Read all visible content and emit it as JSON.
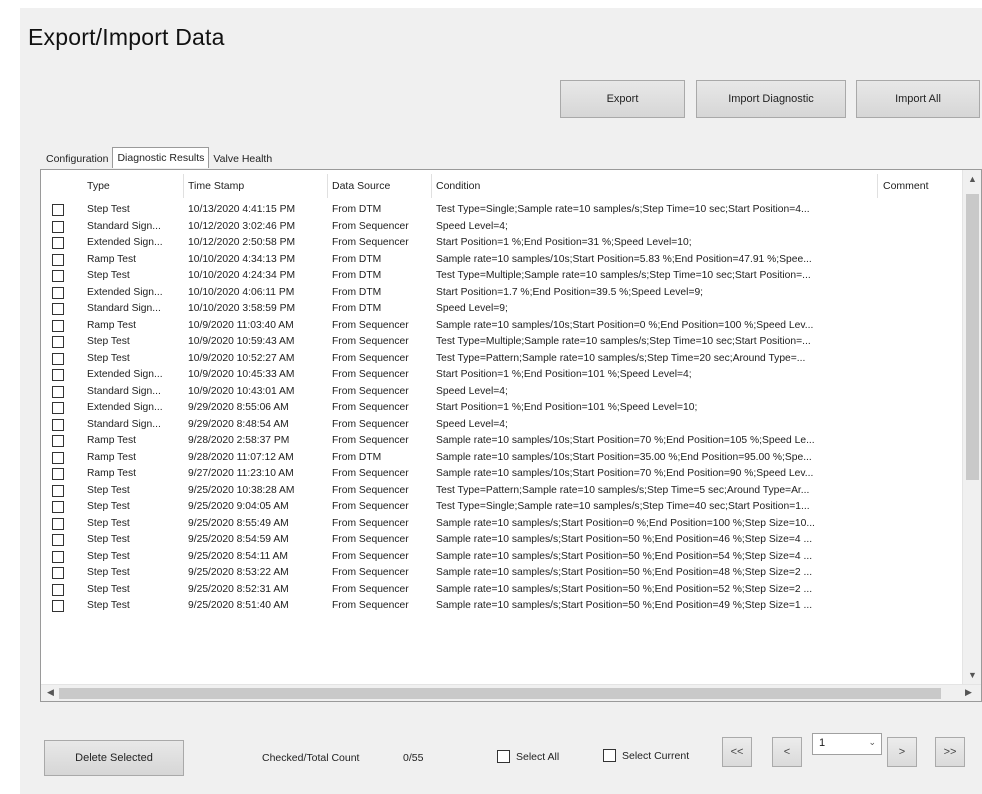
{
  "title": "Export/Import Data",
  "buttons": {
    "export": "Export",
    "import_diagnostic": "Import Diagnostic",
    "import_all": "Import All",
    "delete_selected": "Delete Selected"
  },
  "tabs": [
    {
      "label": "Configuration"
    },
    {
      "label": "Diagnostic Results"
    },
    {
      "label": "Valve Health"
    }
  ],
  "table": {
    "columns": [
      "Type",
      "Time Stamp",
      "Data Source",
      "Condition",
      "Comment"
    ],
    "rows": [
      {
        "type": "Step Test",
        "ts": "10/13/2020 4:41:15 PM",
        "src": "From DTM",
        "cond": "Test Type=Single;Sample rate=10 samples/s;Step Time=10 sec;Start Position=4..."
      },
      {
        "type": "Standard Sign...",
        "ts": "10/12/2020 3:02:46 PM",
        "src": "From Sequencer",
        "cond": "Speed Level=4;"
      },
      {
        "type": "Extended Sign...",
        "ts": "10/12/2020 2:50:58 PM",
        "src": "From Sequencer",
        "cond": "Start Position=1 %;End Position=31 %;Speed Level=10;"
      },
      {
        "type": "Ramp Test",
        "ts": "10/10/2020 4:34:13 PM",
        "src": "From DTM",
        "cond": "Sample rate=10 samples/10s;Start Position=5.83 %;End Position=47.91 %;Spee..."
      },
      {
        "type": "Step Test",
        "ts": "10/10/2020 4:24:34 PM",
        "src": "From DTM",
        "cond": "Test Type=Multiple;Sample rate=10 samples/s;Step Time=10 sec;Start Position=..."
      },
      {
        "type": "Extended Sign...",
        "ts": "10/10/2020 4:06:11 PM",
        "src": "From DTM",
        "cond": "Start Position=1.7 %;End Position=39.5 %;Speed Level=9;"
      },
      {
        "type": "Standard Sign...",
        "ts": "10/10/2020 3:58:59 PM",
        "src": "From DTM",
        "cond": "Speed Level=9;"
      },
      {
        "type": "Ramp Test",
        "ts": "10/9/2020 11:03:40 AM",
        "src": "From Sequencer",
        "cond": "Sample rate=10 samples/10s;Start Position=0 %;End Position=100 %;Speed Lev..."
      },
      {
        "type": "Step Test",
        "ts": "10/9/2020 10:59:43 AM",
        "src": "From Sequencer",
        "cond": "Test Type=Multiple;Sample rate=10 samples/s;Step Time=10 sec;Start Position=..."
      },
      {
        "type": "Step Test",
        "ts": "10/9/2020 10:52:27 AM",
        "src": "From Sequencer",
        "cond": "Test Type=Pattern;Sample rate=10 samples/s;Step Time=20 sec;Around Type=..."
      },
      {
        "type": "Extended Sign...",
        "ts": "10/9/2020 10:45:33 AM",
        "src": "From Sequencer",
        "cond": "Start Position=1 %;End Position=101 %;Speed Level=4;"
      },
      {
        "type": "Standard Sign...",
        "ts": "10/9/2020 10:43:01 AM",
        "src": "From Sequencer",
        "cond": "Speed Level=4;"
      },
      {
        "type": "Extended Sign...",
        "ts": "9/29/2020 8:55:06 AM",
        "src": "From Sequencer",
        "cond": "Start Position=1 %;End Position=101 %;Speed Level=10;"
      },
      {
        "type": "Standard Sign...",
        "ts": "9/29/2020 8:48:54 AM",
        "src": "From Sequencer",
        "cond": "Speed Level=4;"
      },
      {
        "type": "Ramp Test",
        "ts": "9/28/2020 2:58:37 PM",
        "src": "From Sequencer",
        "cond": "Sample rate=10 samples/10s;Start Position=70 %;End Position=105 %;Speed Le..."
      },
      {
        "type": "Ramp Test",
        "ts": "9/28/2020 11:07:12 AM",
        "src": "From DTM",
        "cond": "Sample rate=10 samples/10s;Start Position=35.00 %;End Position=95.00 %;Spe..."
      },
      {
        "type": "Ramp Test",
        "ts": "9/27/2020 11:23:10 AM",
        "src": "From Sequencer",
        "cond": "Sample rate=10 samples/10s;Start Position=70 %;End Position=90 %;Speed Lev..."
      },
      {
        "type": "Step Test",
        "ts": "9/25/2020 10:38:28 AM",
        "src": "From Sequencer",
        "cond": "Test Type=Pattern;Sample rate=10 samples/s;Step Time=5 sec;Around Type=Ar..."
      },
      {
        "type": "Step Test",
        "ts": "9/25/2020 9:04:05 AM",
        "src": "From Sequencer",
        "cond": "Test Type=Single;Sample rate=10 samples/s;Step Time=40 sec;Start Position=1..."
      },
      {
        "type": "Step Test",
        "ts": "9/25/2020 8:55:49 AM",
        "src": "From Sequencer",
        "cond": "Sample rate=10 samples/s;Start Position=0 %;End Position=100 %;Step Size=10..."
      },
      {
        "type": "Step Test",
        "ts": "9/25/2020 8:54:59 AM",
        "src": "From Sequencer",
        "cond": "Sample rate=10 samples/s;Start Position=50 %;End Position=46 %;Step Size=4 ..."
      },
      {
        "type": "Step Test",
        "ts": "9/25/2020 8:54:11 AM",
        "src": "From Sequencer",
        "cond": "Sample rate=10 samples/s;Start Position=50 %;End Position=54 %;Step Size=4 ..."
      },
      {
        "type": "Step Test",
        "ts": "9/25/2020 8:53:22 AM",
        "src": "From Sequencer",
        "cond": "Sample rate=10 samples/s;Start Position=50 %;End Position=48 %;Step Size=2 ..."
      },
      {
        "type": "Step Test",
        "ts": "9/25/2020 8:52:31 AM",
        "src": "From Sequencer",
        "cond": "Sample rate=10 samples/s;Start Position=50 %;End Position=52 %;Step Size=2 ..."
      },
      {
        "type": "Step Test",
        "ts": "9/25/2020 8:51:40 AM",
        "src": "From Sequencer",
        "cond": "Sample rate=10 samples/s;Start Position=50 %;End Position=49 %;Step Size=1 ..."
      }
    ]
  },
  "footer": {
    "count_label": "Checked/Total Count",
    "count_value": "0/55",
    "select_all": "Select All",
    "select_current": "Select Current",
    "page": "1",
    "nav_first": "<<",
    "nav_prev": "<",
    "nav_next": ">",
    "nav_last": ">>"
  }
}
